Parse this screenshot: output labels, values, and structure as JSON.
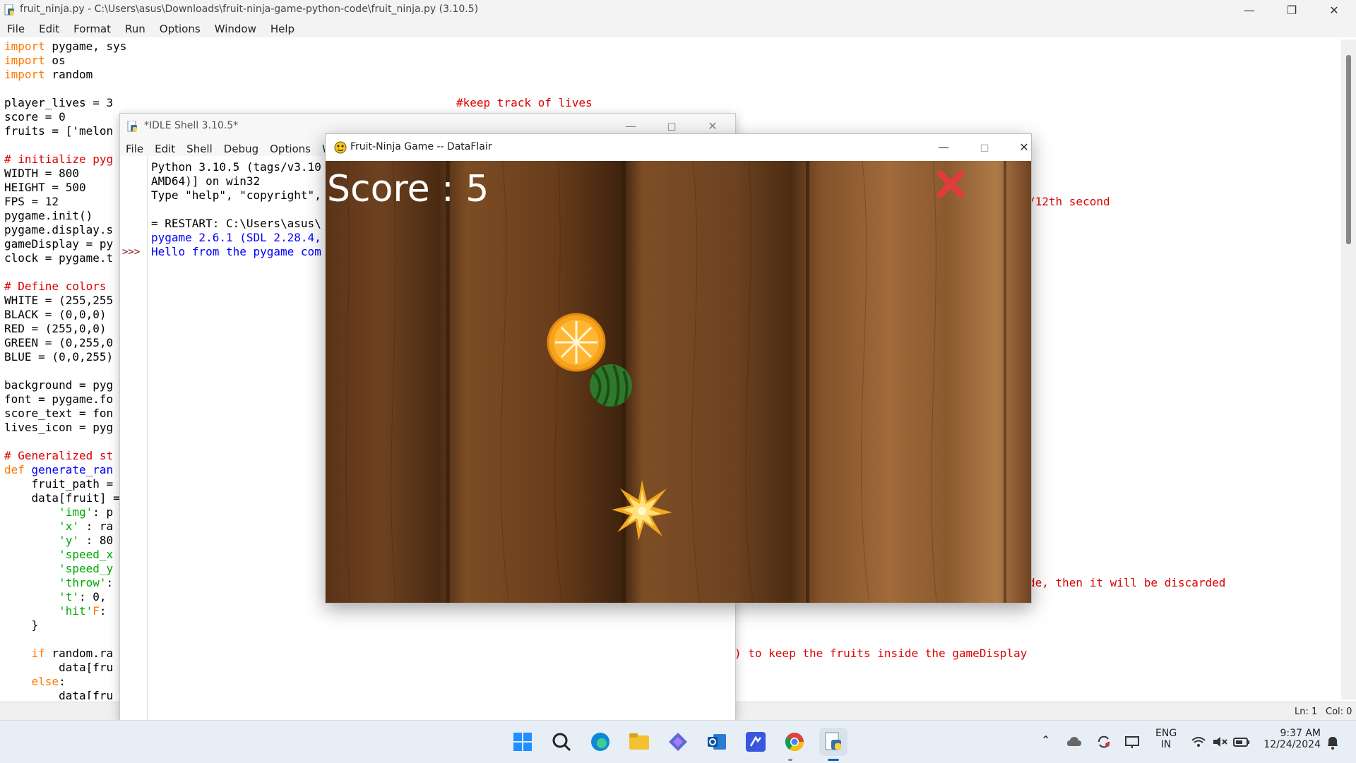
{
  "editor": {
    "title": "fruit_ninja.py - C:\\Users\\asus\\Downloads\\fruit-ninja-game-python-code\\fruit_ninja.py (3.10.5)",
    "menu": [
      "File",
      "Edit",
      "Format",
      "Run",
      "Options",
      "Window",
      "Help"
    ],
    "status": {
      "line": "Ln: 1",
      "col": "Col: 0"
    },
    "code_lines": [
      {
        "a": "import",
        "b": " pygame, sys"
      },
      {
        "a": "import",
        "b": " os"
      },
      {
        "a": "import",
        "b": " random"
      },
      {
        "a": "",
        "b": ""
      },
      {
        "a": "",
        "b": "player_lives = 3"
      },
      {
        "a": "",
        "b": "score = 0"
      },
      {
        "a": "",
        "b": "fruits = ['melon"
      },
      {
        "a": "",
        "b": ""
      },
      {
        "a": "",
        "b": "",
        "c": "# initialize pyg"
      },
      {
        "a": "",
        "b": "WIDTH = 800"
      },
      {
        "a": "",
        "b": "HEIGHT = 500"
      },
      {
        "a": "",
        "b": "FPS = 12"
      },
      {
        "a": "",
        "b": "pygame.init()"
      },
      {
        "a": "",
        "b": "pygame.display.s"
      },
      {
        "a": "",
        "b": "gameDisplay = py"
      },
      {
        "a": "",
        "b": "clock = pygame.t"
      },
      {
        "a": "",
        "b": ""
      },
      {
        "a": "",
        "b": "",
        "c": "# Define colors"
      },
      {
        "a": "",
        "b": "WHITE = (255,255"
      },
      {
        "a": "",
        "b": "BLACK = (0,0,0)"
      },
      {
        "a": "",
        "b": "RED = (255,0,0)"
      },
      {
        "a": "",
        "b": "GREEN = (0,255,0"
      },
      {
        "a": "",
        "b": "BLUE = (0,0,255)"
      },
      {
        "a": "",
        "b": ""
      },
      {
        "a": "",
        "b": "background = pyg"
      },
      {
        "a": "",
        "b": "font = pygame.fo"
      },
      {
        "a": "",
        "b": "score_text = fon"
      },
      {
        "a": "",
        "b": "lives_icon = pyg"
      },
      {
        "a": "",
        "b": ""
      },
      {
        "a": "",
        "b": "",
        "c": "# Generalized st"
      },
      {
        "a": "def",
        "b": " ",
        "d": "generate_ran"
      },
      {
        "a": "",
        "b": "    fruit_path ="
      },
      {
        "a": "",
        "b": "    data[fruit] ="
      },
      {
        "a": "",
        "b": "        ",
        "s": "'img'",
        "e": ": p"
      },
      {
        "a": "",
        "b": "        ",
        "s": "'x'",
        "e": " : ra"
      },
      {
        "a": "",
        "b": "        ",
        "s": "'y'",
        "e": " : 80"
      },
      {
        "a": "",
        "b": "        ",
        "s": "'speed_x",
        "e": ""
      },
      {
        "a": "",
        "b": "        ",
        "s": "'speed_y",
        "e": ""
      },
      {
        "a": "",
        "b": "        ",
        "s": "'throw'",
        "e": ":"
      },
      {
        "a": "",
        "b": "        ",
        "s": "'t'",
        "e": ": 0,"
      },
      {
        "a": "",
        "b": "        ",
        "s": "'hit'",
        "e": ": ",
        "k": "F"
      },
      {
        "a": "",
        "b": "    }"
      },
      {
        "a": "",
        "b": ""
      },
      {
        "a": "",
        "b": "    ",
        "k": "if",
        "e": " random.ra"
      },
      {
        "a": "",
        "b": "        data[fru"
      },
      {
        "a": "",
        "b": "    ",
        "k": "else",
        "e": ":"
      },
      {
        "a": "",
        "b": "        data[fru"
      }
    ],
    "right_comments": [
      {
        "text": "#keep track of lives",
        "row": 4
      },
      {
        "text": "/12th second",
        "row": 11
      },
      {
        "text": "de, then it will be discarded",
        "row": 38
      },
      {
        "text": ") to keep the fruits inside the gameDisplay",
        "row": 43
      }
    ]
  },
  "shell": {
    "title": "*IDLE Shell 3.10.5*",
    "menu": [
      "File",
      "Edit",
      "Shell",
      "Debug",
      "Options",
      "W"
    ],
    "prompt": ">>>",
    "lines": [
      {
        "text": "Python 3.10.5 (tags/v3.10",
        "color": "#000"
      },
      {
        "text": "AMD64)] on win32",
        "color": "#000"
      },
      {
        "text": "Type \"help\", \"copyright\",",
        "color": "#000"
      },
      {
        "text": "",
        "color": "#000"
      },
      {
        "text": "= RESTART: C:\\Users\\asus\\",
        "color": "#000"
      },
      {
        "text": "pygame 2.6.1 (SDL 2.28.4,",
        "color": "#0000ff"
      },
      {
        "text": "Hello from the pygame com",
        "color": "#0000ff"
      }
    ]
  },
  "game": {
    "title": "Fruit-Ninja Game -- DataFlair",
    "score_text": "Score : 5",
    "lives_lost_icon": "red-x-icon",
    "fruits": [
      "orange",
      "watermelon"
    ],
    "explosion": "bomb-explosion"
  },
  "taskbar": {
    "apps": [
      "windows-start-icon",
      "search-icon",
      "edge-icon",
      "file-explorer-icon",
      "copilot-icon",
      "outlook-icon",
      "vscode-icon",
      "chrome-icon",
      "idle-python-icon"
    ],
    "tray": {
      "lang_line1": "ENG",
      "lang_line2": "IN",
      "time": "9:37 AM",
      "date": "12/24/2024"
    }
  },
  "colors": {
    "keyword": "#ff7700",
    "comment": "#dd0000",
    "string": "#00aa00",
    "definition": "#0000ff",
    "wood": "#7a4722",
    "taskbar": "#e8eef5"
  }
}
